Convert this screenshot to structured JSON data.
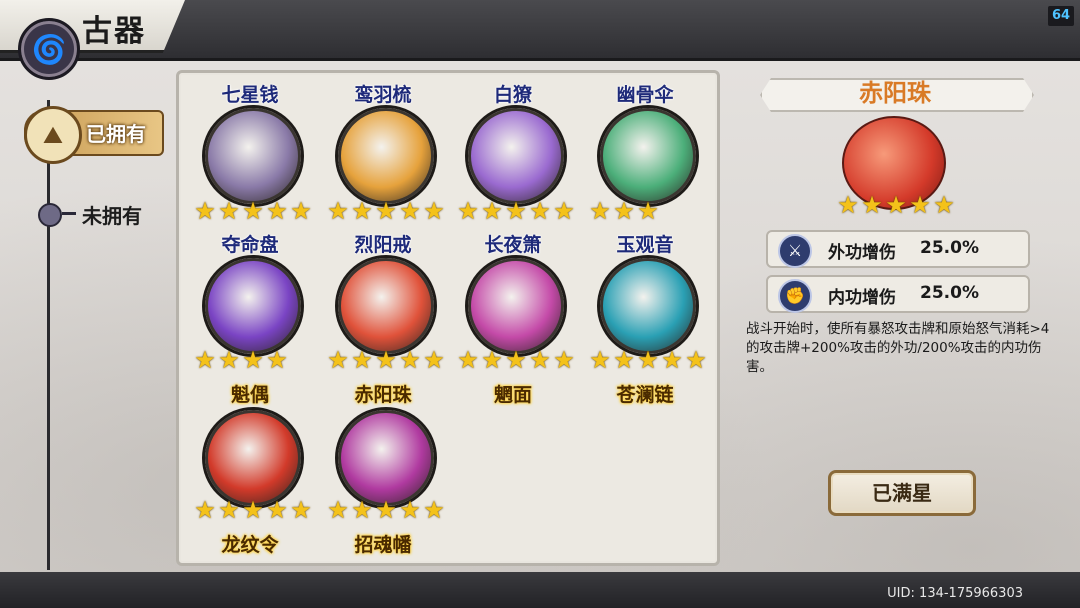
{
  "header": {
    "title": "古器",
    "back_icon": "swirl-back-icon",
    "fps": "64"
  },
  "tabs": [
    {
      "label": "已拥有",
      "selected": true
    },
    {
      "label": "未拥有",
      "selected": false
    }
  ],
  "items": [
    {
      "name": "七星钱",
      "stars": 5,
      "color": "#8a7aa8",
      "name_style": "blue"
    },
    {
      "name": "鸾羽梳",
      "stars": 5,
      "color": "#e6a23c",
      "name_style": "blue"
    },
    {
      "name": "白獠",
      "stars": 5,
      "color": "#9a6ad0",
      "name_style": "blue"
    },
    {
      "name": "幽骨伞",
      "stars": 3,
      "color": "#4caf7a",
      "name_style": "blue"
    },
    {
      "name": "夺命盘",
      "stars": 4,
      "color": "#7a44c4",
      "name_style": "blue"
    },
    {
      "name": "烈阳戒",
      "stars": 5,
      "color": "#e0523a",
      "name_style": "blue"
    },
    {
      "name": "长夜箫",
      "stars": 5,
      "color": "#c44aa8",
      "name_style": "blue"
    },
    {
      "name": "玉观音",
      "stars": 5,
      "color": "#2aa0b4",
      "name_style": "blue"
    },
    {
      "name": "魁偶",
      "stars": 5,
      "color": "#d23a2a",
      "name_style": "gold"
    },
    {
      "name": "赤阳珠",
      "stars": 5,
      "color": "#b03aa0",
      "name_style": "gold"
    },
    {
      "name": "魍面",
      "stars": 0,
      "color": "",
      "name_style": "gold"
    },
    {
      "name": "苍澜链",
      "stars": 0,
      "color": "",
      "name_style": "gold"
    },
    {
      "name": "龙纹令",
      "stars": 0,
      "color": "",
      "name_style": "gold"
    },
    {
      "name": "招魂幡",
      "stars": 0,
      "color": "",
      "name_style": "gold"
    }
  ],
  "detail": {
    "name": "赤阳珠",
    "stars": 5,
    "stats": [
      {
        "icon": "blade-icon",
        "label": "外功增伤",
        "value": "25.0%"
      },
      {
        "icon": "fist-icon",
        "label": "内功增伤",
        "value": "25.0%"
      }
    ],
    "description": "战斗开始时，使所有暴怒攻击牌和原始怒气消耗>4的攻击牌+200%攻击的外功/200%攻击的内功伤害。",
    "button": "已满星"
  },
  "footer": {
    "uid": "UID: 134-175966303"
  }
}
